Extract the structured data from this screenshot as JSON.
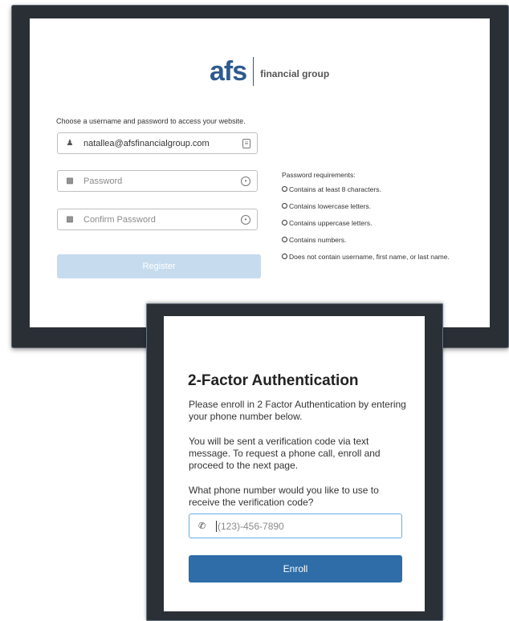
{
  "register": {
    "logo": {
      "mark": "afs",
      "text": "financial group"
    },
    "instructions": "Choose a username and password to access your website.",
    "username": {
      "value": "natallea@afsfinancialgroup.com"
    },
    "password": {
      "placeholder": "Password"
    },
    "confirm_password": {
      "placeholder": "Confirm Password"
    },
    "register_label": "Register",
    "requirements": {
      "title": "Password requirements:",
      "items": [
        "Contains at least 8 characters.",
        "Contains lowercase letters.",
        "Contains uppercase letters.",
        "Contains numbers.",
        "Does not contain username, first name, or last name."
      ]
    }
  },
  "two_factor": {
    "title": "2-Factor Authentication",
    "intro": "Please enroll in 2 Factor Authentication by entering your phone number below.",
    "info": "You will be sent a verification code via text message. To request a phone call, enroll and proceed to the next page.",
    "question": "What phone number would you like to use to receive the verification code?",
    "phone": {
      "placeholder": "(123)-456-7890",
      "value": ""
    },
    "enroll_label": "Enroll"
  },
  "icons": {
    "user": "user-icon",
    "lock": "lock-icon",
    "phone": "phone-icon",
    "contact_card": "contact-card-icon",
    "eye": "eye-icon"
  }
}
